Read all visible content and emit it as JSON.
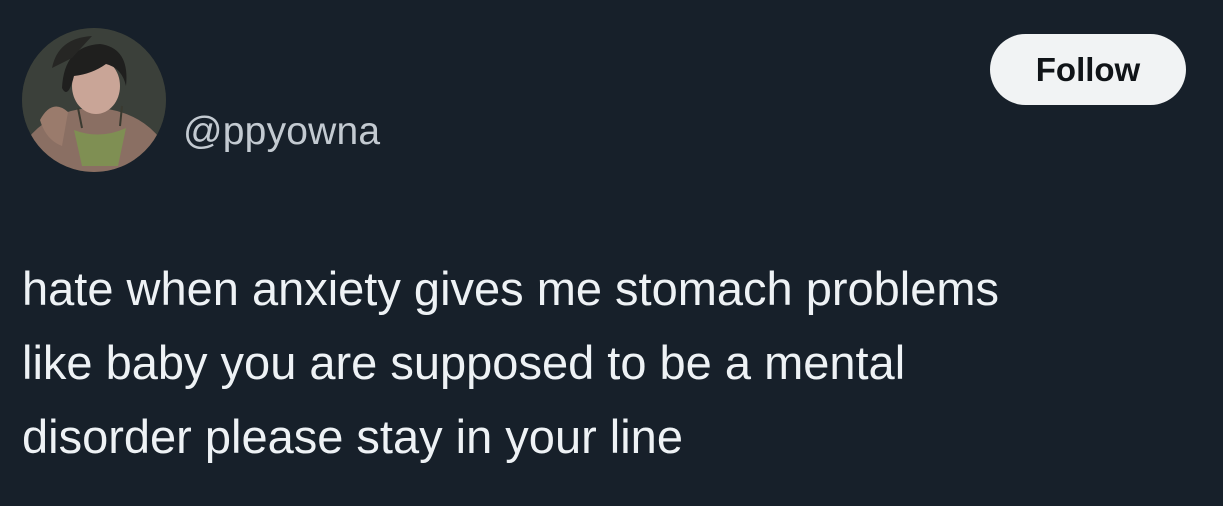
{
  "tweet": {
    "handle": "@ppyowna",
    "follow_label": "Follow",
    "text_lines": [
      "hate when anxiety gives me stomach problems",
      "like baby you are supposed to be a mental",
      "disorder please stay in your line"
    ]
  },
  "colors": {
    "background": "#17202a",
    "text": "#eef2f5",
    "handle": "#c3cad1",
    "follow_button_bg": "#f1f3f4",
    "follow_button_text": "#101418"
  }
}
